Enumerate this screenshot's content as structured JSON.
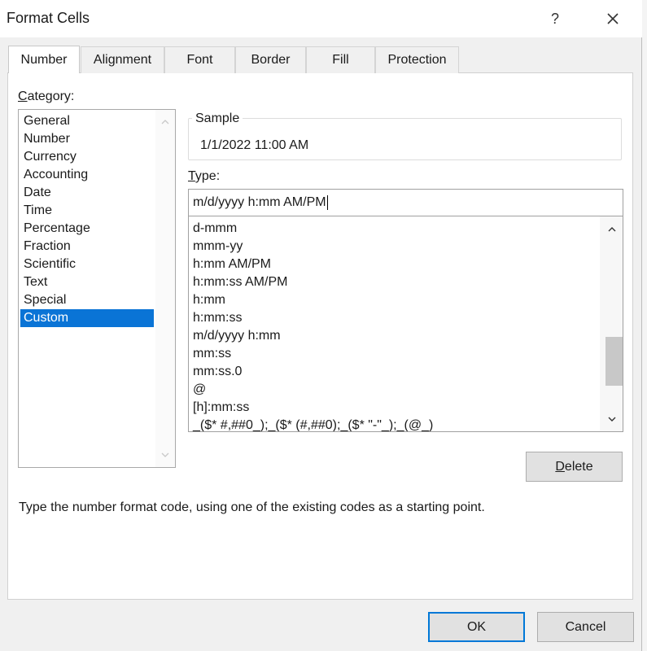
{
  "window": {
    "title": "Format Cells",
    "help_label": "?",
    "close_label": "✕"
  },
  "tabs": [
    {
      "label": "Number"
    },
    {
      "label": "Alignment"
    },
    {
      "label": "Font"
    },
    {
      "label": "Border"
    },
    {
      "label": "Fill"
    },
    {
      "label": "Protection"
    }
  ],
  "category": {
    "label_first": "C",
    "label_rest": "ategory:",
    "items": [
      "General",
      "Number",
      "Currency",
      "Accounting",
      "Date",
      "Time",
      "Percentage",
      "Fraction",
      "Scientific",
      "Text",
      "Special",
      "Custom"
    ],
    "selected": "Custom"
  },
  "sample": {
    "label": "Sample",
    "value": "1/1/2022 11:00 AM"
  },
  "type": {
    "label_first": "T",
    "label_rest": "ype:",
    "value": "m/d/yyyy h:mm AM/PM",
    "items": [
      "d-mmm",
      "mmm-yy",
      "h:mm AM/PM",
      "h:mm:ss AM/PM",
      "h:mm",
      "h:mm:ss",
      "m/d/yyyy h:mm",
      "mm:ss",
      "mm:ss.0",
      "@",
      "[h]:mm:ss",
      "_($* #,##0_);_($* (#,##0);_($* \"-\"_);_(@_)"
    ]
  },
  "buttons": {
    "delete_first": "D",
    "delete_rest": "elete",
    "ok": "OK",
    "cancel": "Cancel"
  },
  "hint": "Type the number format code, using one of the existing codes as a starting point."
}
